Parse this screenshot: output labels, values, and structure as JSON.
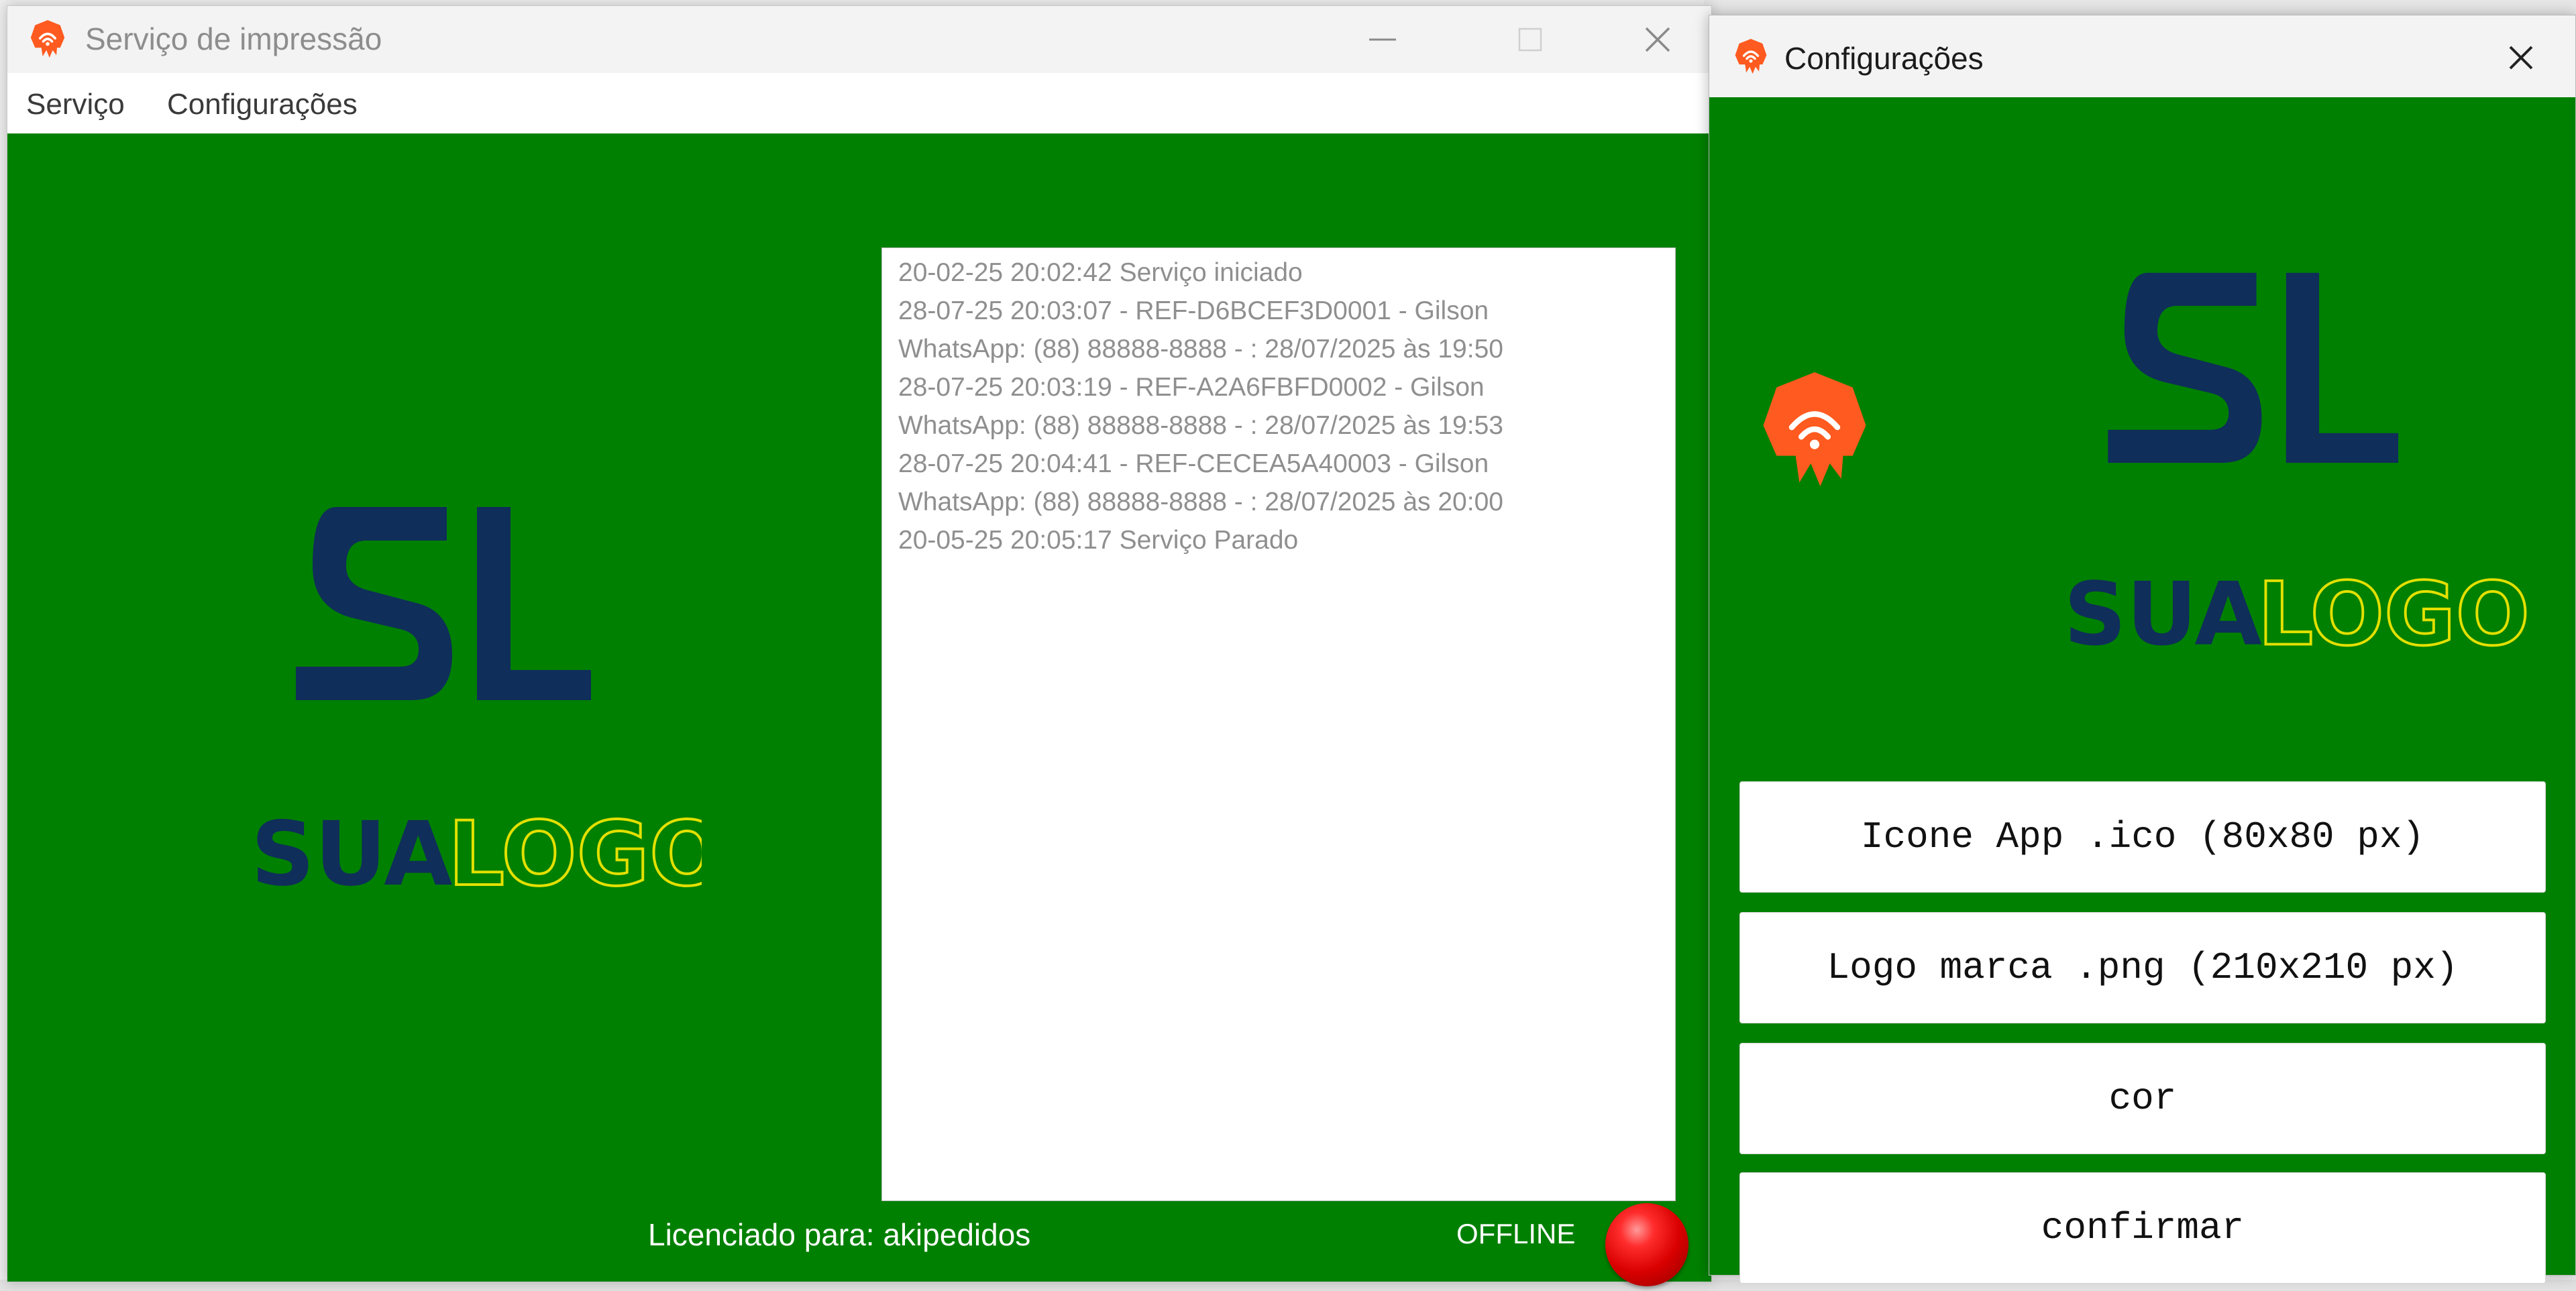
{
  "main_window": {
    "title": "Serviço de impressão",
    "menu": [
      "Serviço",
      "Configurações"
    ],
    "logo": {
      "part1": "SUA",
      "part2": "LOGO"
    },
    "log_lines": [
      "20-02-25 20:02:42 Serviço iniciado",
      "28-07-25 20:03:07 - REF-D6BCEF3D0001 - Gilson",
      "WhatsApp: (88) 88888-8888 - : 28/07/2025 às 19:50",
      "28-07-25 20:03:19 - REF-A2A6FBFD0002 - Gilson",
      "WhatsApp: (88) 88888-8888 - : 28/07/2025 às 19:53",
      "28-07-25 20:04:41 - REF-CECEA5A40003 - Gilson",
      "WhatsApp: (88) 88888-8888 - : 28/07/2025 às 20:00",
      "20-05-25 20:05:17 Serviço Parado"
    ],
    "license_text": "Licenciado para: akipedidos",
    "status_text": "OFFLINE"
  },
  "settings_window": {
    "title": "Configurações",
    "logo": {
      "part1": "SUA",
      "part2": "LOGO"
    },
    "buttons": {
      "app_icon": "Icone App .ico (80x80 px)",
      "logo": "Logo marca .png (210x210 px)",
      "color": "cor",
      "confirm": "confirmar"
    }
  },
  "colors": {
    "background_green": "#008000",
    "logo_navy": "#0f2e5a",
    "logo_yellow": "#e3e000",
    "icon_orange": "#ff5a1f",
    "status_red": "#e00000"
  },
  "icons": {
    "app": "orange-printer-badge-icon",
    "minimize": "minimize-icon",
    "maximize": "maximize-icon",
    "close": "close-icon"
  }
}
